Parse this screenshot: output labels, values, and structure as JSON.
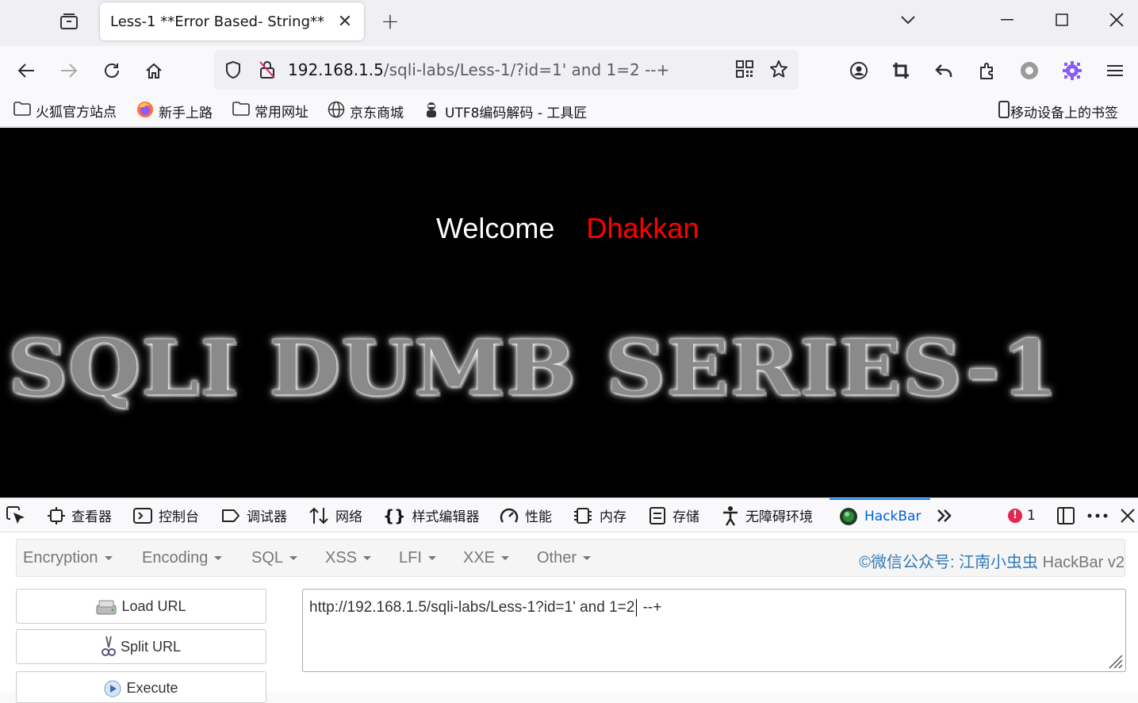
{
  "browser": {
    "tab_title": "Less-1 **Error Based- String**",
    "url_host": "192.168.1.5",
    "url_path": "/sqli-labs/Less-1/?id=1' and 1=2 --+"
  },
  "bookmarks": [
    {
      "label": "火狐官方站点",
      "icon": "folder-icon"
    },
    {
      "label": "新手上路",
      "icon": "firefox-icon"
    },
    {
      "label": "常用网址",
      "icon": "folder-icon"
    },
    {
      "label": "京东商城",
      "icon": "globe-icon"
    },
    {
      "label": "UTF8编码解码 - 工具匠",
      "icon": "site-icon"
    }
  ],
  "mobile_bookmarks": "移动设备上的书签",
  "page": {
    "welcome": "Welcome",
    "name": "Dhakkan",
    "banner": "SQLI DUMB SERIES-1"
  },
  "devtools": {
    "tabs": [
      "查看器",
      "控制台",
      "调试器",
      "网络",
      "样式编辑器",
      "性能",
      "内存",
      "存储",
      "无障碍环境",
      "HackBar"
    ],
    "active_tab": "HackBar",
    "error_count": "1"
  },
  "hackbar": {
    "menus": [
      "Encryption",
      "Encoding",
      "SQL",
      "XSS",
      "LFI",
      "XXE",
      "Other"
    ],
    "brand_prefix": "©微信公众号: 江南小虫虫",
    "brand_suffix": " HackBar v2",
    "buttons": [
      "Load URL",
      "Split URL",
      "Execute"
    ],
    "url_before_cursor": "http://192.168.1.5/sqli-labs/Less-1?id=1' and 1=2",
    "url_after_cursor": " --+"
  },
  "colors": {
    "accent": "#0a84ff",
    "welcome_name": "#ff0000",
    "hackbar_brand": "#337ab7"
  }
}
